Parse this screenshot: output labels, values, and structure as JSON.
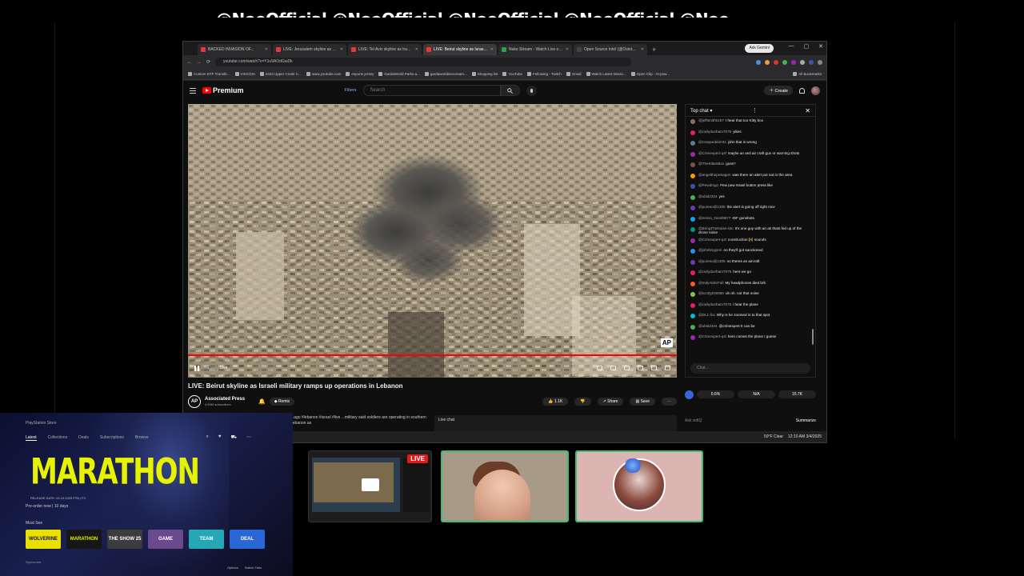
{
  "overlay": {
    "handle": "@NoeOfficial @NoeOfficial @NoeOfficial @NoeOfficial @Noe"
  },
  "browser": {
    "tabs": [
      {
        "label": "BACKED INVASION OF...",
        "active": false
      },
      {
        "label": "LIVE: Jerusalem skyline as Isr...",
        "active": false
      },
      {
        "label": "LIVE: Tel Aviv skyline as Iran m...",
        "active": false
      },
      {
        "label": "LIVE: Beirut skyline as Israeli...",
        "active": true
      },
      {
        "label": "Nuke Stream - Watch Live on K...",
        "active": false
      },
      {
        "label": "Open Source Intel (@Osint...",
        "active": false
      }
    ],
    "new_tab": "+",
    "ask_gemini": "Ask Gemini",
    "window_controls": [
      "—",
      "▢",
      "✕"
    ],
    "url": "youtube.com/watch?v=Y1u9AOdGwDk",
    "bookmarks": [
      "Custom DTF Transfe...",
      "VISCOSI",
      "2323 Upper Creek C...",
      "www.youtube.com",
      "esports jersey",
      "GardaWorld Parks a...",
      "gardaworldsecuream...",
      "Shopping list",
      "YouTube",
      "Following - Twitch",
      "Gmail",
      "Watch Latest Movie...",
      "Open Clip - AI-pow...",
      "All Bookmarks"
    ]
  },
  "youtube": {
    "logo": "Premium",
    "filters": "Filters",
    "search_placeholder": "Search",
    "create": "Create",
    "video_title": "LIVE: Beirut skyline as Israeli military ramps up operations in Lebanon",
    "live_label": "Live",
    "ap_logo": "AP",
    "channel": {
      "name": "Associated Press",
      "subs": "4.59M subscribers",
      "avatar_text": "AP"
    },
    "remix": "Remix",
    "likes": "1.1K",
    "share": "Share",
    "save": "Save",
    "description": "...ago  #lebanon #israel #live  ...military said soldiers are operating in southern Lebanon as",
    "live_chat_box": "Live chat",
    "chat": {
      "header": "Top chat",
      "input_placeholder": "Chat...",
      "messages": [
        {
          "user": "@jeffsmith6187",
          "text": "I hear that too Kitty box",
          "color": "#8d6e63"
        },
        {
          "user": "@carlydunham7075",
          "text": "yikes",
          "color": "#e91e63"
        },
        {
          "user": "@cosepeddo031",
          "text": "john that is wrong",
          "color": "#607d8b"
        },
        {
          "user": "@Crimexpert-q4l",
          "text": "maybe an anti air craft gun or warning shots",
          "color": "#9c27b0"
        },
        {
          "user": "@TheKittenBox",
          "text": "guss?",
          "color": "#795548"
        },
        {
          "user": "@angelthepretagen",
          "text": "was there an alert put out in the area",
          "color": "#ff9800"
        },
        {
          "user": "@Pewdmgo",
          "text": "Pew pew Israel button press like",
          "color": "#3f51b5"
        },
        {
          "user": "@ubid2324",
          "text": "yes",
          "color": "#4caf50"
        },
        {
          "user": "@pureso@1305",
          "text": "the alert is going off right now",
          "color": "#673ab7"
        },
        {
          "user": "@nesso_snesl8877",
          "text": "IDF gunshots",
          "color": "#03a9f4"
        },
        {
          "user": "@BringTheNoise-s3c",
          "text": "It's one guy with an ak thats fed up of the drone noise",
          "color": "#009688"
        },
        {
          "user": "@Crimexpert-q4l",
          "text": "construction 🚧 sounds",
          "color": "#9c27b0"
        },
        {
          "user": "@johnboyjonn",
          "text": "no they'll got sanctioned",
          "color": "#2196f3"
        },
        {
          "user": "@pureso@1305",
          "text": "no theres an aircraft",
          "color": "#673ab7"
        },
        {
          "user": "@carlydunham7075",
          "text": "here we go",
          "color": "#e91e63"
        },
        {
          "user": "@IndyAlderFall",
          "text": "My headphones died brb",
          "color": "#ff5722"
        },
        {
          "user": "@scotty040660",
          "text": "uh oh. not that noise",
          "color": "#8bc34a"
        },
        {
          "user": "@carlydunham7075",
          "text": "i hear the plane",
          "color": "#e91e63"
        },
        {
          "user": "@DL1-fox",
          "text": "Why is he zoomed in to that spot",
          "color": "#00bcd4"
        },
        {
          "user": "@ubid2324",
          "text": "@crimexpert It can be",
          "color": "#4caf50"
        },
        {
          "user": "@Crimexpert-q4l",
          "text": "hero comes the plane I guess",
          "color": "#9c27b0"
        }
      ]
    },
    "poll": {
      "values": [
        "0.6%",
        "N/A",
        "15.7K"
      ]
    },
    "ask": "Ask vidIQ",
    "summarize": "Summarize"
  },
  "taskbar": {
    "weather": "59°F Clear",
    "time": "12:10 AM",
    "date": "3/4/2025"
  },
  "playstation": {
    "nav": "PlayStation Store",
    "tabs": [
      "Latest",
      "Collections",
      "Deals",
      "Subscriptions",
      "Browse"
    ],
    "game_title": "MARATHON",
    "game_meta": "RELEASE DATE: 09.23.2025  PS5 | PC",
    "preorder": "Pre-order now  |  10 days",
    "row_label": "Must See",
    "tiles": [
      {
        "label": "WOLVERINE",
        "bg": "#e9e000",
        "fg": "#111"
      },
      {
        "label": "MARATHON",
        "bg": "#161616",
        "fg": "#e6f200"
      },
      {
        "label": "THE SHOW 25",
        "bg": "#3c3c3c",
        "fg": "#fff"
      },
      {
        "label": "GAME",
        "bg": "#6a4a8c",
        "fg": "#fff"
      },
      {
        "label": "TEAM",
        "bg": "#26a7b5",
        "fg": "#fff"
      },
      {
        "label": "DEAL",
        "bg": "#2a67d6",
        "fg": "#fff"
      }
    ],
    "sponsored": "Sponsored",
    "bottom_actions": [
      "Options",
      "Switch Tabs"
    ]
  },
  "cams": {
    "live_badge": "LIVE"
  }
}
